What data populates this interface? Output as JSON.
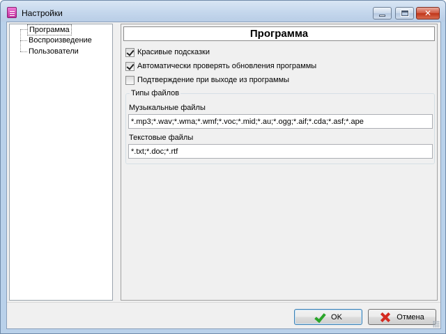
{
  "window": {
    "title": "Настройки",
    "controls": {
      "minimize_icon": "minimize-icon",
      "maximize_icon": "maximize-icon",
      "close_icon": "close-icon",
      "close_glyph": "✕"
    }
  },
  "tree": {
    "items": [
      {
        "label": "Программа",
        "selected": true
      },
      {
        "label": "Воспроизведение",
        "selected": false
      },
      {
        "label": "Пользователи",
        "selected": false
      }
    ]
  },
  "panel": {
    "header": "Программа",
    "checkboxes": [
      {
        "label": "Красивые подсказки",
        "checked": true
      },
      {
        "label": "Автоматически проверять обновления программы",
        "checked": true
      },
      {
        "label": "Подтверждение при выходе из программы",
        "checked": false
      }
    ],
    "file_types": {
      "title": "Типы файлов",
      "music_label": "Музыкальные файлы",
      "music_value": "*.mp3;*.wav;*.wma;*.wmf;*.voc;*.mid;*.au;*.ogg;*.aif;*.cda;*.asf;*.ape",
      "text_label": "Текстовые файлы",
      "text_value": "*.txt;*.doc;*.rtf"
    }
  },
  "buttons": {
    "ok_label": "OK",
    "cancel_label": "Отмена"
  },
  "colors": {
    "frame": "#b9d1ea",
    "close_button": "#c03519",
    "ok_icon": "#2aa52a",
    "cancel_icon": "#d42a20"
  }
}
